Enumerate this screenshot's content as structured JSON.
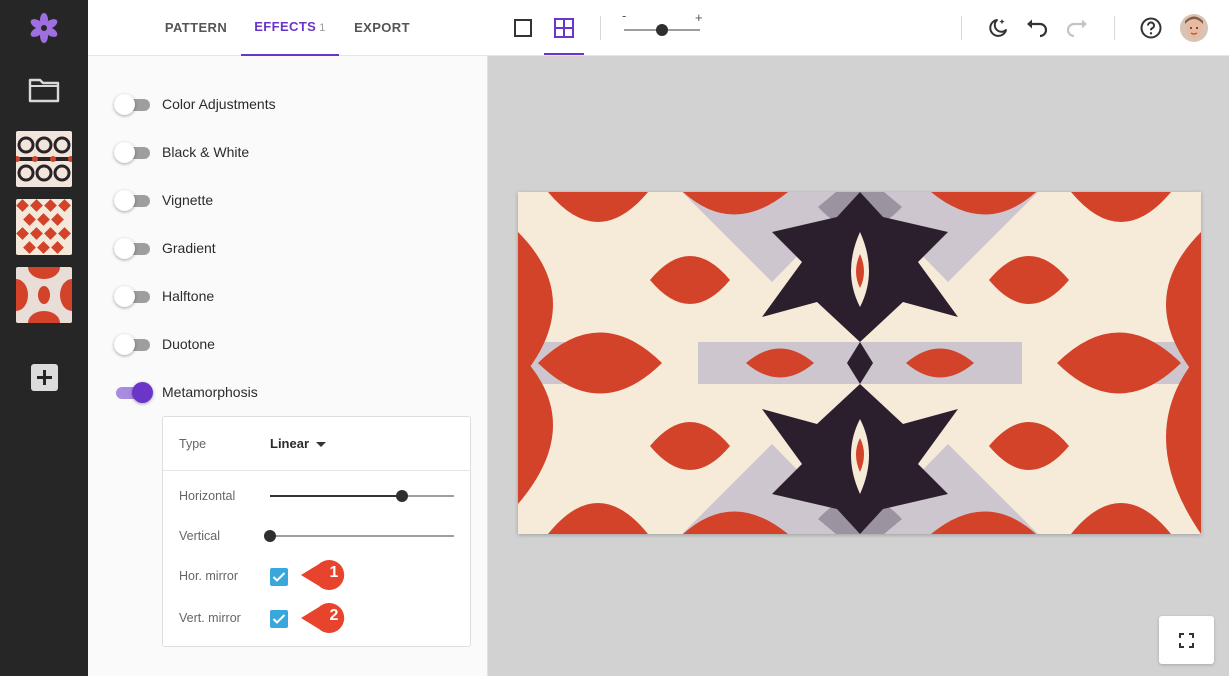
{
  "app": {
    "accent": "#6c35c9"
  },
  "rail": {
    "logo_icon": "flower-logo-icon",
    "folder_icon": "folder-icon",
    "thumbnails": [
      {
        "name": "pattern-thumb-1"
      },
      {
        "name": "pattern-thumb-2"
      },
      {
        "name": "pattern-thumb-3"
      }
    ],
    "add_icon": "plus-square-icon"
  },
  "tabs": [
    {
      "label": "PATTERN",
      "active": false
    },
    {
      "label": "EFFECTS",
      "badge": "1",
      "active": true
    },
    {
      "label": "EXPORT",
      "active": false
    }
  ],
  "effects": [
    {
      "label": "Color Adjustments",
      "on": false
    },
    {
      "label": "Black & White",
      "on": false
    },
    {
      "label": "Vignette",
      "on": false
    },
    {
      "label": "Gradient",
      "on": false
    },
    {
      "label": "Halftone",
      "on": false
    },
    {
      "label": "Duotone",
      "on": false
    },
    {
      "label": "Metamorphosis",
      "on": true
    }
  ],
  "metamorphosis": {
    "type_label": "Type",
    "type_value": "Linear",
    "horizontal_label": "Horizontal",
    "horizontal_value": 0.72,
    "vertical_label": "Vertical",
    "vertical_value": 0.0,
    "hor_mirror_label": "Hor. mirror",
    "hor_mirror_checked": true,
    "vert_mirror_label": "Vert. mirror",
    "vert_mirror_checked": true,
    "markers": [
      "1",
      "2"
    ],
    "marker_color": "#e8432d",
    "checkbox_color": "#3aa7dc"
  },
  "toolbar": {
    "single_view_icon": "single-square-icon",
    "grid_view_icon": "grid-2x2-icon",
    "zoom_minus": "-",
    "zoom_plus": "+",
    "zoom_value": 0.5,
    "theme_icon": "moon-stars-icon",
    "undo_icon": "undo-icon",
    "redo_icon": "redo-icon",
    "help_icon": "help-circle-icon",
    "avatar_icon": "user-avatar"
  },
  "canvas": {
    "background": "#d2d2d2",
    "pattern_colors": {
      "red": "#d2432a",
      "cream": "#f6ead8",
      "lilac": "#cdc6cf",
      "mauve": "#9c93a0",
      "dark": "#2b1f2e"
    },
    "fullscreen_icon": "fullscreen-icon"
  }
}
